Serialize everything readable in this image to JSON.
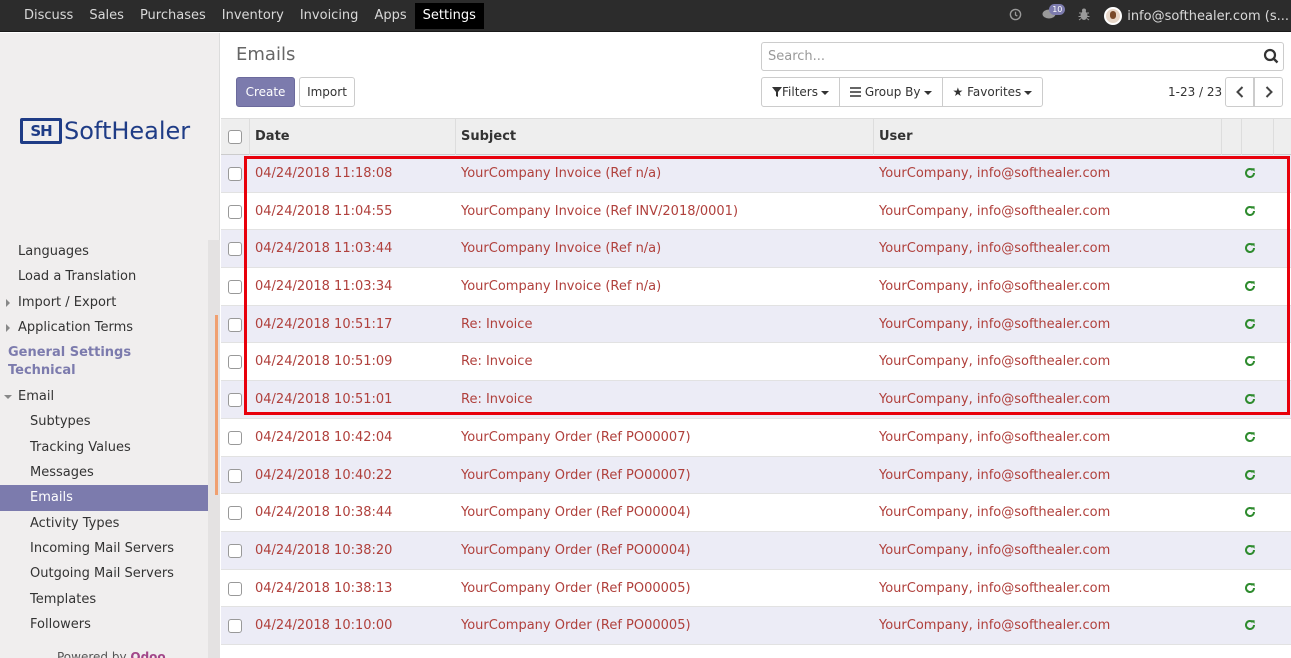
{
  "topbar": {
    "menu": [
      "Discuss",
      "Sales",
      "Purchases",
      "Inventory",
      "Invoicing",
      "Apps",
      "Settings"
    ],
    "active_menu": "Settings",
    "messages_badge": "10",
    "user": "info@softhealer.com (s..."
  },
  "sidebar": {
    "logo_mark": "SH",
    "logo_word": "SoftHealer",
    "items_top": [
      {
        "label": "Languages",
        "caret": false
      },
      {
        "label": "Load a Translation",
        "caret": false
      },
      {
        "label": "Import / Export",
        "caret": true
      },
      {
        "label": "Application Terms",
        "caret": true
      }
    ],
    "section_headers": [
      "General Settings",
      "Technical"
    ],
    "email_group": "Email",
    "email_items": [
      "Subtypes",
      "Tracking Values",
      "Messages",
      "Emails",
      "Activity Types",
      "Incoming Mail Servers",
      "Outgoing Mail Servers",
      "Templates",
      "Followers"
    ],
    "active_item": "Emails",
    "powered_by": "Powered by",
    "powered_brand": "Odoo"
  },
  "control": {
    "title": "Emails",
    "create_label": "Create",
    "import_label": "Import",
    "search_placeholder": "Search...",
    "filters_label": "Filters",
    "groupby_label": "Group By",
    "favorites_label": "Favorites",
    "pager": "1-23 / 23"
  },
  "table": {
    "columns": [
      "Date",
      "Subject",
      "User"
    ],
    "rows": [
      {
        "date": "04/24/2018 11:18:08",
        "subject": "YourCompany Invoice (Ref n/a)",
        "user": "YourCompany, info@softhealer.com"
      },
      {
        "date": "04/24/2018 11:04:55",
        "subject": "YourCompany Invoice (Ref INV/2018/0001)",
        "user": "YourCompany, info@softhealer.com"
      },
      {
        "date": "04/24/2018 11:03:44",
        "subject": "YourCompany Invoice (Ref n/a)",
        "user": "YourCompany, info@softhealer.com"
      },
      {
        "date": "04/24/2018 11:03:34",
        "subject": "YourCompany Invoice (Ref n/a)",
        "user": "YourCompany, info@softhealer.com"
      },
      {
        "date": "04/24/2018 10:51:17",
        "subject": "Re: Invoice",
        "user": "YourCompany, info@softhealer.com"
      },
      {
        "date": "04/24/2018 10:51:09",
        "subject": "Re: Invoice",
        "user": "YourCompany, info@softhealer.com"
      },
      {
        "date": "04/24/2018 10:51:01",
        "subject": "Re: Invoice",
        "user": "YourCompany, info@softhealer.com"
      },
      {
        "date": "04/24/2018 10:42:04",
        "subject": "YourCompany Order (Ref PO00007)",
        "user": "YourCompany, info@softhealer.com"
      },
      {
        "date": "04/24/2018 10:40:22",
        "subject": "YourCompany Order (Ref PO00007)",
        "user": "YourCompany, info@softhealer.com"
      },
      {
        "date": "04/24/2018 10:38:44",
        "subject": "YourCompany Order (Ref PO00004)",
        "user": "YourCompany, info@softhealer.com"
      },
      {
        "date": "04/24/2018 10:38:20",
        "subject": "YourCompany Order (Ref PO00004)",
        "user": "YourCompany, info@softhealer.com"
      },
      {
        "date": "04/24/2018 10:38:13",
        "subject": "YourCompany Order (Ref PO00005)",
        "user": "YourCompany, info@softhealer.com"
      },
      {
        "date": "04/24/2018 10:10:00",
        "subject": "YourCompany Order (Ref PO00005)",
        "user": "YourCompany, info@softhealer.com"
      }
    ]
  },
  "colors": {
    "brand": "#7c7bad",
    "row_text": "#b0403c",
    "retry_icon": "#2e8b2e",
    "highlight": "#e8000b"
  }
}
